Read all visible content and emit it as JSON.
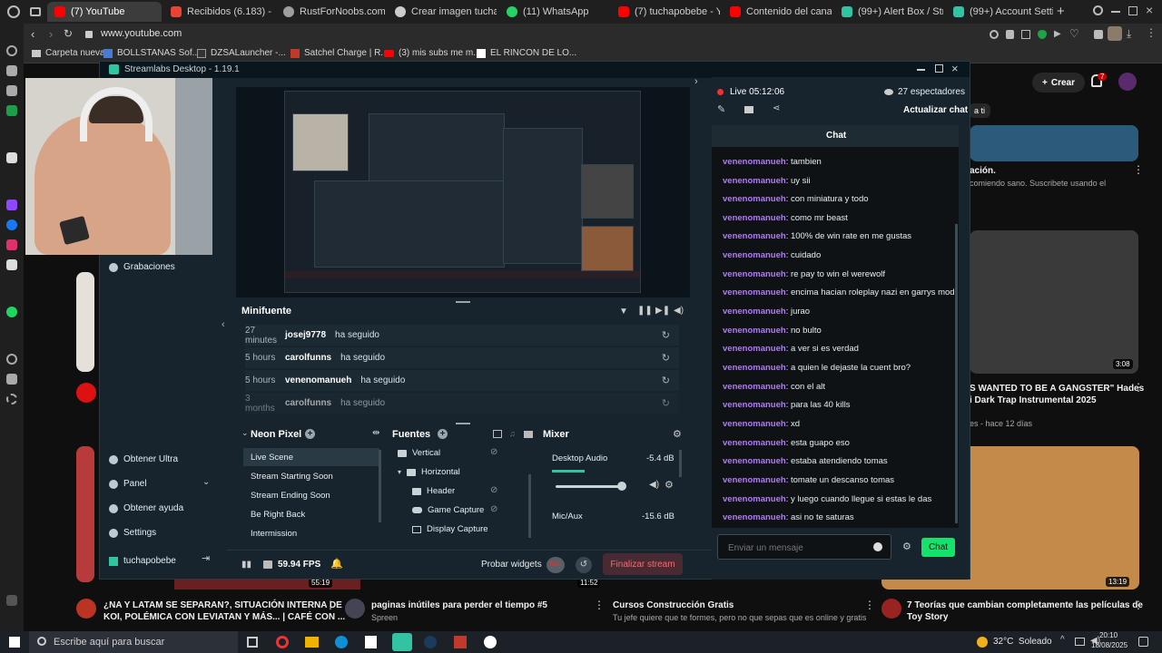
{
  "browser": {
    "tabs": [
      {
        "label": "(7) YouTube",
        "color": "#ff0000",
        "active": true
      },
      {
        "label": "Recibidos (6.183) - gian",
        "color": "#ea4335"
      },
      {
        "label": "RustForNoobs.com | Mo",
        "color": "#9e9e9e"
      },
      {
        "label": "Crear imagen tuchapo",
        "color": "#cccccc"
      },
      {
        "label": "(11) WhatsApp",
        "color": "#25d366"
      },
      {
        "label": "(7) tuchapobebe - YouT",
        "color": "#ff0000"
      },
      {
        "label": "Contenido del canal - Y",
        "color": "#ff0000"
      },
      {
        "label": "(99+) Alert Box / Stream",
        "color": "#31c3a2"
      },
      {
        "label": "(99+) Account Settings",
        "color": "#31c3a2"
      }
    ],
    "url": "www.youtube.com",
    "bookmarks": [
      {
        "label": "Carpeta nueva"
      },
      {
        "label": "BOLLSTANAS Sof..."
      },
      {
        "label": "DZSALauncher -..."
      },
      {
        "label": "Satchel Charge | R..."
      },
      {
        "label": "(3) mis subs me m..."
      },
      {
        "label": "EL RINCON DE LO..."
      }
    ]
  },
  "youtube": {
    "create_label": "Crear",
    "notif_count": "7",
    "for_you": "a ti",
    "videos": [
      {
        "title": "ación.",
        "sub": "comiendo sano. Suscribete usando el"
      },
      {
        "title": "S WANTED TO BE A GANGSTER\" Hades",
        "title2": "i Dark Trap Instrumental 2025",
        "sub": "es - hace 12 días",
        "duration": "3:08"
      },
      {
        "title": "¿NA Y LATAM SE SEPARAN?, SITUACIÓN INTERNA DE",
        "title2": "KOI, POLÉMICA CON LEVIATAN Y MÁS... | CAFÉ CON ...",
        "duration": "55:19"
      },
      {
        "title": "paginas inútiles para perder el tiempo #5",
        "sub": "Spreen",
        "duration": "11:52"
      },
      {
        "title": "Cursos Construcción Gratis",
        "sub": "Tu jefe quiere que te formes, pero no que sepas que es online y gratis"
      },
      {
        "title": "7 Teorías que cambian completamente las películas de",
        "title2": "Toy Story",
        "duration": "13:19"
      }
    ]
  },
  "streamlabs": {
    "title": "Streamlabs Desktop - 1.19.1",
    "nav": {
      "grabaciones": "Grabaciones",
      "obtener_ultra": "Obtener Ultra",
      "panel": "Panel",
      "obtener_ayuda": "Obtener ayuda",
      "settings": "Settings",
      "user": "tuchapobebe"
    },
    "minifuente": {
      "title": "Minifuente",
      "events": [
        {
          "time": "27 minutes",
          "user": "josej9778",
          "action": "ha seguido"
        },
        {
          "time": "5 hours",
          "user": "carolfunns",
          "action": "ha seguido"
        },
        {
          "time": "5 hours",
          "user": "venenomanueh",
          "action": "ha seguido"
        },
        {
          "time": "3 months",
          "user": "carolfunns",
          "action": "ha seguido"
        }
      ]
    },
    "scenes": {
      "title": "Neon Pixel",
      "items": [
        "Live Scene",
        "Stream Starting Soon",
        "Stream Ending Soon",
        "Be Right Back",
        "Intermission"
      ]
    },
    "sources": {
      "title": "Fuentes",
      "items": [
        "Vertical",
        "Horizontal",
        "Header",
        "Game Capture",
        "Display Capture"
      ]
    },
    "mixer": {
      "title": "Mixer",
      "channels": [
        {
          "name": "Desktop Audio",
          "level": "-5.4 dB"
        },
        {
          "name": "Mic/Aux",
          "level": "-15.6 dB"
        }
      ]
    },
    "footer": {
      "fps": "59.94 FPS",
      "probar": "Probar widgets",
      "rec": "REC",
      "finalizar": "Finalizar stream"
    },
    "live": {
      "label": "Live",
      "time": "05:12:06",
      "viewers": "27 espectadores",
      "refresh": "Actualizar chat"
    },
    "chat": {
      "title": "Chat",
      "messages": [
        {
          "user": "venenomanueh",
          "text": ": tambien"
        },
        {
          "user": "venenomanueh",
          "text": ": uy sii"
        },
        {
          "user": "venenomanueh",
          "text": ": con miniatura y todo"
        },
        {
          "user": "venenomanueh",
          "text": ": como mr beast"
        },
        {
          "user": "venenomanueh",
          "text": ": 100% de win rate en me gustas"
        },
        {
          "user": "venenomanueh",
          "text": ": cuidado"
        },
        {
          "user": "venenomanueh",
          "text": ": re pay to win el werewolf"
        },
        {
          "user": "venenomanueh",
          "text": ": encima hacian roleplay nazi en garrys mod"
        },
        {
          "user": "venenomanueh",
          "text": ": jurao"
        },
        {
          "user": "venenomanueh",
          "text": ": no bulto"
        },
        {
          "user": "venenomanueh",
          "text": ": a ver si es verdad"
        },
        {
          "user": "venenomanueh",
          "text": ": a quien le dejaste la cuent bro?"
        },
        {
          "user": "venenomanueh",
          "text": ": con el alt"
        },
        {
          "user": "venenomanueh",
          "text": ": para las 40 kills"
        },
        {
          "user": "venenomanueh",
          "text": ": xd"
        },
        {
          "user": "venenomanueh",
          "text": ": esta guapo eso"
        },
        {
          "user": "venenomanueh",
          "text": ": estaba atendiendo tomas"
        },
        {
          "user": "venenomanueh",
          "text": ": tomate un descanso tomas"
        },
        {
          "user": "venenomanueh",
          "text": ": y luego cuando llegue si estas le das"
        },
        {
          "user": "venenomanueh",
          "text": ": asi no te saturas"
        }
      ],
      "placeholder": "Enviar un mensaje",
      "send": "Chat"
    }
  },
  "taskbar": {
    "search": "Escribe aquí para buscar",
    "weather": "32°C  Soleado",
    "time": "20:10",
    "date": "18/08/2025"
  }
}
